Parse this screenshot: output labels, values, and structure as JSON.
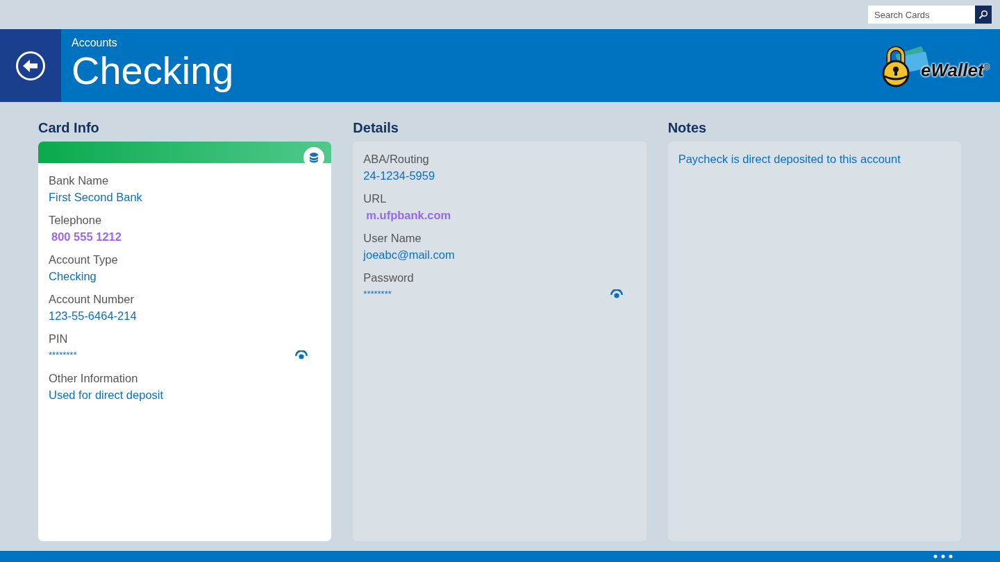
{
  "search": {
    "placeholder": "Search Cards"
  },
  "header": {
    "breadcrumb": "Accounts",
    "title": "Checking",
    "logo": {
      "name": "eWallet",
      "mark": "®"
    }
  },
  "card_info": {
    "title": "Card Info",
    "fields": [
      {
        "label": "Bank Name",
        "value": "First Second Bank",
        "kind": "text"
      },
      {
        "label": "Telephone",
        "value": "800 555 1212",
        "kind": "link"
      },
      {
        "label": "Account Type",
        "value": "Checking",
        "kind": "text"
      },
      {
        "label": "Account Number",
        "value": "123-55-6464-214",
        "kind": "text"
      },
      {
        "label": "PIN",
        "value": "********",
        "kind": "secret"
      },
      {
        "label": "Other Information",
        "value": "Used for direct deposit",
        "kind": "text"
      }
    ]
  },
  "details": {
    "title": "Details",
    "fields": [
      {
        "label": "ABA/Routing",
        "value": "24-1234-5959",
        "kind": "text"
      },
      {
        "label": "URL",
        "value": "m.ufpbank.com",
        "kind": "link"
      },
      {
        "label": "User Name",
        "value": "joeabc@mail.com",
        "kind": "text"
      },
      {
        "label": "Password",
        "value": "********",
        "kind": "secret"
      }
    ]
  },
  "notes": {
    "title": "Notes",
    "text": "Paycheck is direct deposited to this account"
  }
}
